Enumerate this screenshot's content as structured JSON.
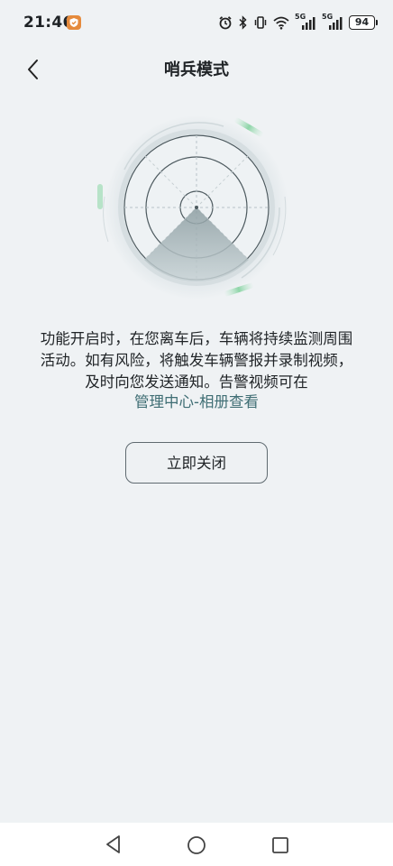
{
  "status_bar": {
    "time": "21:46",
    "network_1": "5G",
    "network_2": "5G",
    "battery": "94"
  },
  "header": {
    "title": "哨兵模式",
    "back_icon": "chevron-left-icon"
  },
  "main": {
    "description": "功能开启时，在您离车后，车辆将持续监测周围活动。如有风险，将触发车辆警报并录制视频，及时向您发送通知。告警视频可在",
    "album_link": "管理中心-相册查看",
    "close_button": "立即关闭"
  },
  "colors": {
    "background": "#eff2f4",
    "accent_green": "#8ed5a8",
    "link": "#3f6e74"
  },
  "navigation_bar": {
    "icons": [
      "triangle-back-icon",
      "circle-home-icon",
      "square-recent-icon"
    ]
  }
}
